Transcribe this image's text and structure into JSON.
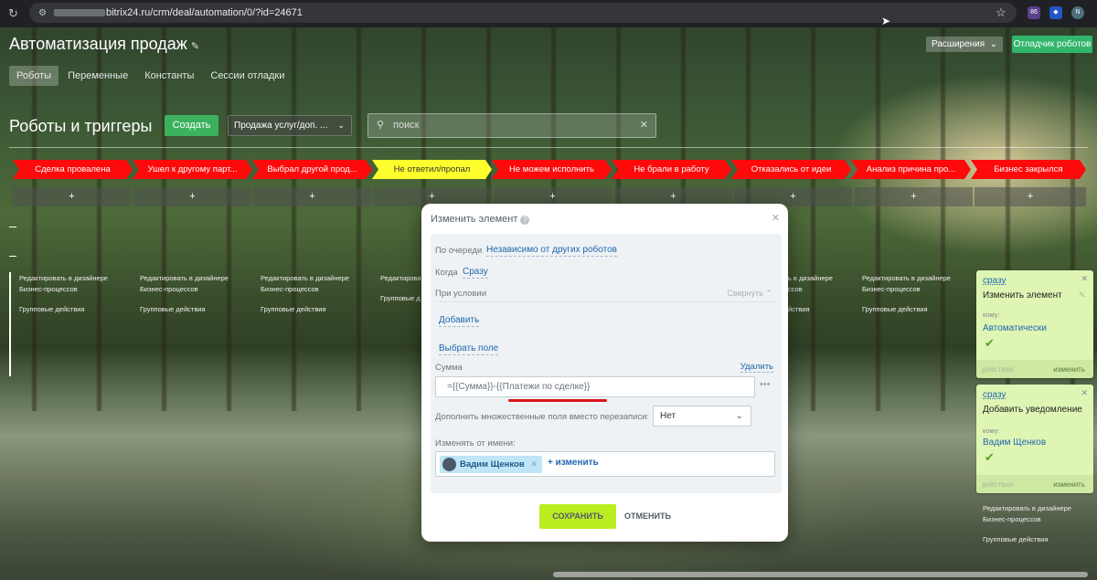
{
  "browser": {
    "url": "bitrix24.ru/crm/deal/automation/0/?id=24671",
    "ext_badge": "86",
    "ext_profile": "N"
  },
  "header": {
    "title": "Автоматизация продаж",
    "btn_extensions": "Расширения",
    "btn_debugger": "Отладчик роботов"
  },
  "tabs": [
    "Роботы",
    "Переменные",
    "Константы",
    "Сессии отладки"
  ],
  "toolbar": {
    "title": "Роботы и триггеры",
    "create_label": "Создать",
    "pipeline": "Продажа услуг/доп. ...",
    "search_placeholder": "поиск"
  },
  "stages": [
    {
      "label": "Сделка провалена",
      "color": "#ff0a0a"
    },
    {
      "label": "Ушел к другому парт...",
      "color": "#ff0a0a"
    },
    {
      "label": "Выбрал другой прод...",
      "color": "#ff0a0a"
    },
    {
      "label": "Не ответил/пропал",
      "color": "#ffff2e"
    },
    {
      "label": "Не можем исполнить",
      "color": "#ff0a0a"
    },
    {
      "label": "Не брали в работу",
      "color": "#ff0a0a"
    },
    {
      "label": "Отказались от идеи",
      "color": "#ff0a0a"
    },
    {
      "label": "Анализ причина про...",
      "color": "#ff0a0a"
    },
    {
      "label": "Бизнес закрылся",
      "color": "#ff0a0a"
    }
  ],
  "column_footer": {
    "edit": "Редактировать в дизайнере Бизнес-процессов",
    "group": "Групповые действия"
  },
  "modal": {
    "title": "Изменить элемент",
    "order_label": "По очереди",
    "order_value": "Независимо от других роботов",
    "when_label": "Когда",
    "when_value": "Сразу",
    "condition_label": "При условии",
    "collapse_label": "Свернуть",
    "add_label": "Добавить",
    "choose_field": "Выбрать поле",
    "field_label": "Сумма",
    "delete_label": "Удалить",
    "field_value": "={{Сумма}}-{{Платежи по сделке}}",
    "append_label": "Дополнить множественные поля вместо перезаписи:",
    "append_value": "Нет",
    "change_from_label": "Изменять от имени:",
    "user": "Вадим Щенков",
    "change_link": "+ изменить",
    "save": "СОХРАНИТЬ",
    "cancel": "ОТМЕНИТЬ"
  },
  "cards": [
    {
      "when": "сразу",
      "name": "Изменить элемент",
      "to_label": "кому:",
      "who": "Автоматически",
      "foot_left": "действия",
      "foot_right": "изменить"
    },
    {
      "when": "сразу",
      "name": "Добавить уведомление",
      "to_label": "кому:",
      "who": "Вадим Щенков",
      "foot_left": "действия",
      "foot_right": "изменить"
    }
  ],
  "right_footer": {
    "edit": "Редактировать в дизайнере Бизнес-процессов",
    "group": "Групповые действия"
  }
}
